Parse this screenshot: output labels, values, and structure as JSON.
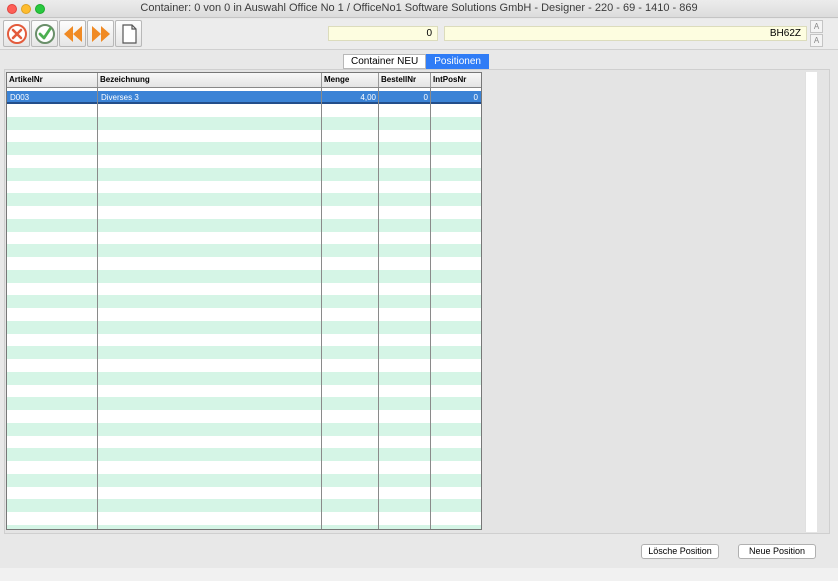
{
  "window": {
    "title": "Container: 0 von 0 in Auswahl Office No 1 /  OfficeNo1 Software Solutions GmbH - Designer - 220 - 69 - 1410 - 869"
  },
  "toolbar": {
    "cancel_icon": "cancel-x-icon",
    "ok_icon": "checkmark-icon",
    "prev_icon": "arrow-left-icon",
    "next_icon": "arrow-right-icon",
    "new_icon": "document-icon",
    "colors": {
      "cancel": "#e35b3c",
      "ok": "#4caf50",
      "arrow": "#f08a24"
    }
  },
  "header": {
    "field_number": "0",
    "field_code": "BH62Z"
  },
  "tabs": [
    {
      "label": "Container NEU",
      "active": false
    },
    {
      "label": "Positionen",
      "active": true
    }
  ],
  "table": {
    "columns": [
      "ArtikelNr",
      "Bezeichnung",
      "Menge",
      "BestellNr",
      "IntPosNr"
    ],
    "rows": [
      {
        "artikelnr": "D003",
        "bezeichnung": "Diverses 3",
        "menge": "4,00",
        "bestellnr": "0",
        "intposnr": "0"
      }
    ],
    "colors": {
      "selected": "#3b83d6",
      "alt_row": "#d5f5e6"
    }
  },
  "buttons": {
    "delete": "Lösche Position",
    "new": "Neue Position"
  }
}
